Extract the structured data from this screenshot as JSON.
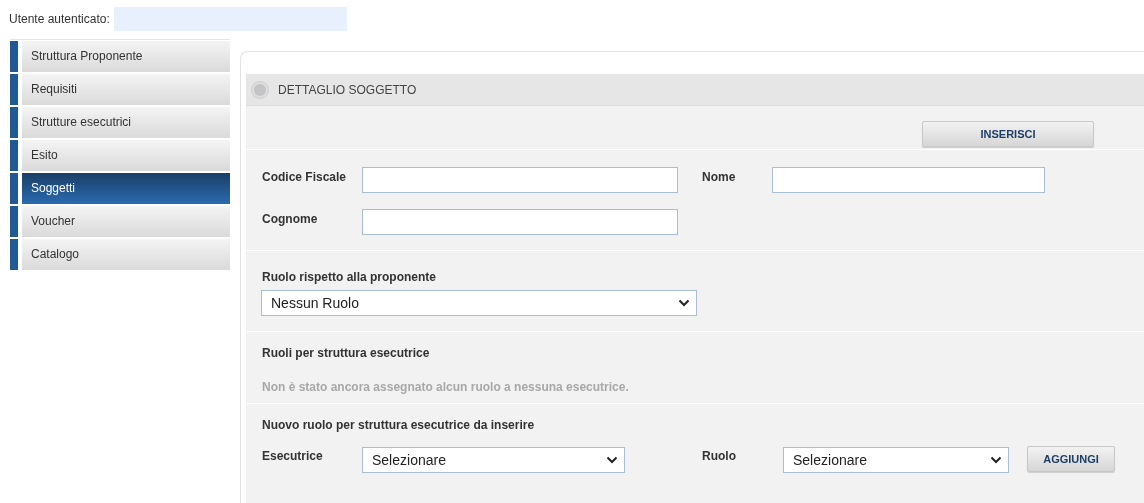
{
  "user": {
    "label": "Utente autenticato:"
  },
  "sidebar": {
    "items": [
      {
        "label": "Struttura Proponente",
        "selected": false
      },
      {
        "label": "Requisiti",
        "selected": false
      },
      {
        "label": "Strutture esecutrici",
        "selected": false
      },
      {
        "label": "Esito",
        "selected": false
      },
      {
        "label": "Soggetti",
        "selected": true
      },
      {
        "label": "Voucher",
        "selected": false
      },
      {
        "label": "Catalogo",
        "selected": false
      }
    ]
  },
  "panel": {
    "title": "DETTAGLIO SOGGETTO",
    "insert_button": "INSERISCI",
    "fields": [
      {
        "label": "Codice Fiscale"
      },
      {
        "label": "Nome"
      },
      {
        "label": "Cognome"
      }
    ],
    "role_section": {
      "label": "Ruolo rispetto alla proponente",
      "dropdown": {
        "value": "Nessun Ruolo"
      }
    },
    "roles_section": {
      "title": "Ruoli per struttura esecutrice",
      "empty_message": "Non è stato ancora assegnato alcun ruolo a nessuna esecutrice."
    },
    "new_role_section": {
      "title": "Nuovo ruolo per struttura esecutrice da inserire",
      "executor": {
        "label": "Esecutrice",
        "value": "Selezionare"
      },
      "role": {
        "label": "Ruolo",
        "value": "Selezionare"
      },
      "add_button": "AGGIUNGI"
    }
  }
}
